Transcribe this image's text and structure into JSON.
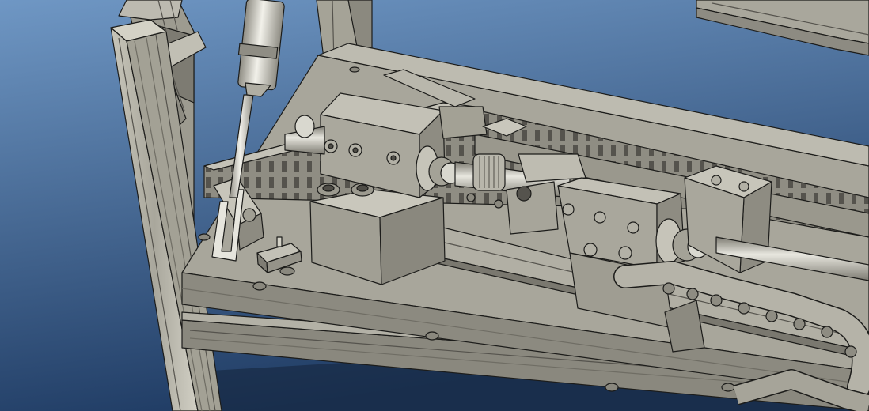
{
  "viewport": {
    "background_top": "#6f97c4",
    "background_bottom": "#1f3b63"
  },
  "model": {
    "metal_light": "#b9b7ab",
    "metal_mid": "#9c9a8f",
    "metal_dark": "#6e6c63",
    "edge": "#1c1c1a",
    "rod_highlight": "#f2f1ea"
  },
  "components": [
    {
      "name": "aluminium-profile-frame"
    },
    {
      "name": "base-plate"
    },
    {
      "name": "gas-spring"
    },
    {
      "name": "bearing-block-left"
    },
    {
      "name": "shaft-coupling"
    },
    {
      "name": "bearing-block-right"
    },
    {
      "name": "linear-guide-rail"
    },
    {
      "name": "cable-drag-chain"
    },
    {
      "name": "limit-switch"
    },
    {
      "name": "cable-duct"
    }
  ]
}
